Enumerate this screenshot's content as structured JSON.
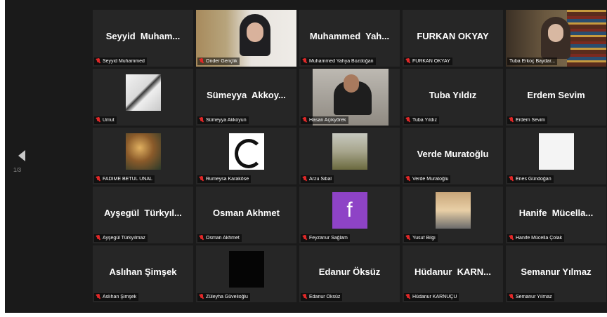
{
  "pager": "1/3",
  "accent_color": "#d8cf67",
  "muted_icon": "mic-muted-icon",
  "tiles": [
    {
      "id": "seyyid",
      "display": "Seyyid  Muham...",
      "label": "Seyyid Muhammed"
    },
    {
      "id": "onder",
      "display": "",
      "label": "Önder Gençlik"
    },
    {
      "id": "muhammed",
      "display": "Muhammed  Yah...",
      "label": "Muhammed Yahya Bozdoğan"
    },
    {
      "id": "furkan",
      "display": "FURKAN OKYAY",
      "label": "FURKAN OKYAY"
    },
    {
      "id": "tuba-erkoc",
      "display": "",
      "label": "Tuba Erkoç Baydar..."
    },
    {
      "id": "umut",
      "display": "",
      "label": "Umut"
    },
    {
      "id": "sumeyya",
      "display": "Sümeyya  Akkoy...",
      "label": "Sümeyya Akkoyun"
    },
    {
      "id": "hasan",
      "display": "",
      "label": "Hasan Açıkyörek"
    },
    {
      "id": "tuba-yildiz",
      "display": "Tuba Yıldız",
      "label": "Tuba Yıldız"
    },
    {
      "id": "erdem",
      "display": "Erdem Sevim",
      "label": "Erdem Sevim"
    },
    {
      "id": "fadime",
      "display": "",
      "label": "FADİME BETÜL ÜNAL"
    },
    {
      "id": "rumeysa",
      "display": "",
      "label": "Rumeysa Karaköse"
    },
    {
      "id": "arzu",
      "display": "",
      "label": "Arzu Sibal"
    },
    {
      "id": "verde",
      "display": "Verde Muratoğlu",
      "label": "Verde Muratoğlu"
    },
    {
      "id": "enes",
      "display": "",
      "label": "Enes Gündoğan"
    },
    {
      "id": "aysegul",
      "display": "Ayşegül  Türkyıl...",
      "label": "Ayşegül Türkyılmaz"
    },
    {
      "id": "osman",
      "display": "Osman Akhmet",
      "label": "Osman Akhmet"
    },
    {
      "id": "feyzanur",
      "display": "",
      "label": "Feyzanur Sağlam",
      "letter": "f"
    },
    {
      "id": "yusuf",
      "display": "",
      "label": "Yusuf Bilgi"
    },
    {
      "id": "hanife",
      "display": "Hanife  Mücella...",
      "label": "Hanife Mücella Çolak"
    },
    {
      "id": "aslihan",
      "display": "Aslıhan Şimşek",
      "label": "Aslıhan Şimşek"
    },
    {
      "id": "zuleyha",
      "display": "",
      "label": "Züleyha Güvelioğlu"
    },
    {
      "id": "edanur",
      "display": "Edanur Öksüz",
      "label": "Edanur Öksüz"
    },
    {
      "id": "hudanur",
      "display": "Hüdanur  KARN...",
      "label": "Hüdanur KARNUÇU"
    },
    {
      "id": "semanur",
      "display": "Semanur Yılmaz",
      "label": "Semanur Yılmaz"
    }
  ]
}
